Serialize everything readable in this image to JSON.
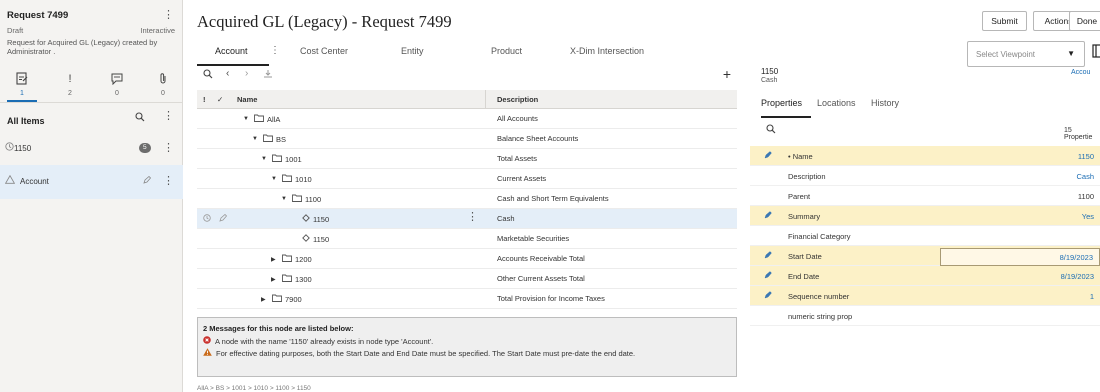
{
  "request": {
    "title": "Request 7499",
    "status": "Draft",
    "mode": "Interactive",
    "description": "Request for Acquired GL (Legacy) created by Administrator ."
  },
  "left_tabs": {
    "items": [
      {
        "icon": "request-items-icon",
        "count": "1"
      },
      {
        "icon": "alert-icon",
        "count": "2"
      },
      {
        "icon": "comments-icon",
        "count": "0"
      },
      {
        "icon": "attachment-icon",
        "count": "0"
      }
    ]
  },
  "left_list": {
    "header": "All Items",
    "items": [
      {
        "label": "1150",
        "badge": "5"
      },
      {
        "label": "Account"
      }
    ]
  },
  "main": {
    "title": "Acquired GL (Legacy) - Request 7499",
    "tabs": [
      "Account",
      "Cost Center",
      "Entity",
      "Product",
      "X-Dim Intersection"
    ]
  },
  "grid": {
    "headers": {
      "flag": "!",
      "check": "✓",
      "name": "Name",
      "description": "Description"
    },
    "rows": [
      {
        "name": "AllA",
        "description": "All Accounts"
      },
      {
        "name": "BS",
        "description": "Balance Sheet Accounts"
      },
      {
        "name": "1001",
        "description": "Total Assets"
      },
      {
        "name": "1010",
        "description": "Current Assets"
      },
      {
        "name": "1100",
        "description": "Cash and Short Term Equivalents"
      },
      {
        "name": "1150",
        "description": "Cash"
      },
      {
        "name": "1150",
        "description": "Marketable Securities"
      },
      {
        "name": "1200",
        "description": "Accounts Receivable Total"
      },
      {
        "name": "1300",
        "description": "Other Current Assets Total"
      },
      {
        "name": "7900",
        "description": "Total Provision for Income Taxes"
      }
    ]
  },
  "messages": {
    "title": "2 Messages for this node are listed below:",
    "items": [
      {
        "severity": "error",
        "text": "A node with the name '1150' already exists in node type 'Account'."
      },
      {
        "severity": "warning",
        "text": "For effective dating purposes, both the Start Date and End Date must be specified. The Start Date must pre-date the end date."
      }
    ]
  },
  "breadcrumb": "AllA > BS > 1001 > 1010 > 1100 > 1150",
  "actions": {
    "submit": "Submit",
    "actions": "Actions",
    "done": "Done"
  },
  "viewpoint": {
    "placeholder": "Select Viewpoint"
  },
  "node": {
    "id": "1150",
    "name": "Cash",
    "type": "Accou"
  },
  "properties": {
    "tabs": [
      "Properties",
      "Locations",
      "History"
    ],
    "count_label": "15 Propertie",
    "rows": [
      {
        "label": "• Name",
        "value": "1150"
      },
      {
        "label": "Description",
        "value": "Cash"
      },
      {
        "label": "Parent",
        "value": "1100"
      },
      {
        "label": "Summary",
        "value": "Yes"
      },
      {
        "label": "Financial Category",
        "value": ""
      },
      {
        "label": "Start Date",
        "value": "8/19/2023"
      },
      {
        "label": "End Date",
        "value": "8/19/2023"
      },
      {
        "label": "Sequence number",
        "value": "1"
      },
      {
        "label": "numeric string prop",
        "value": ""
      }
    ]
  },
  "colors": {
    "accent": "#1b6db4",
    "highlight_row": "#fcf1c7",
    "selected_row": "#e4eef8",
    "error": "#c9302c",
    "warning": "#c96a1a"
  }
}
